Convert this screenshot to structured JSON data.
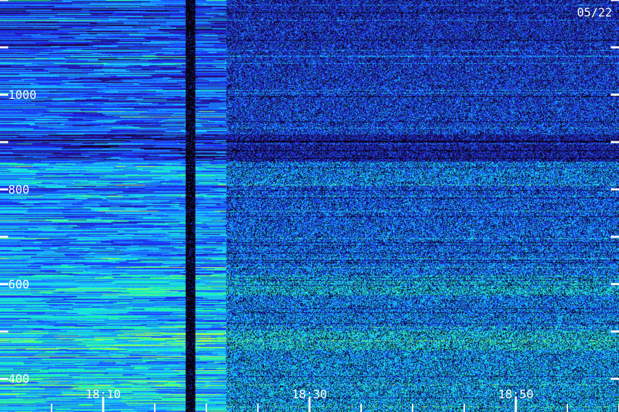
{
  "chart_data": {
    "type": "heatmap",
    "title": "",
    "xlabel": "",
    "ylabel": "",
    "date_label": "05/22",
    "y_axis": {
      "range": [
        330,
        1200
      ],
      "ticks": [
        400,
        600,
        800,
        1000
      ],
      "tick_labels": [
        "400",
        "600",
        "800",
        "1000"
      ]
    },
    "x_axis": {
      "ticks": [
        "18:10",
        "18:30",
        "18:50"
      ],
      "tick_labels": [
        "18:10",
        "18:30",
        "18:50"
      ]
    },
    "colormap": [
      "#000000",
      "#2a0a6e",
      "#1a2cff",
      "#1a7dff",
      "#19d4ff",
      "#1aff9a",
      "#c8ff3c"
    ],
    "regions": [
      {
        "name": "smooth-band",
        "x_fraction": [
          0,
          0.3
        ],
        "texture": "horizontal-streaks"
      },
      {
        "name": "gap",
        "x_fraction": [
          0.3,
          0.315
        ],
        "texture": "dark"
      },
      {
        "name": "granular-band",
        "x_fraction": [
          0.315,
          0.365
        ],
        "texture": "horizontal-streaks"
      },
      {
        "name": "noise-band",
        "x_fraction": [
          0.365,
          1.0
        ],
        "texture": "speckle"
      }
    ]
  }
}
